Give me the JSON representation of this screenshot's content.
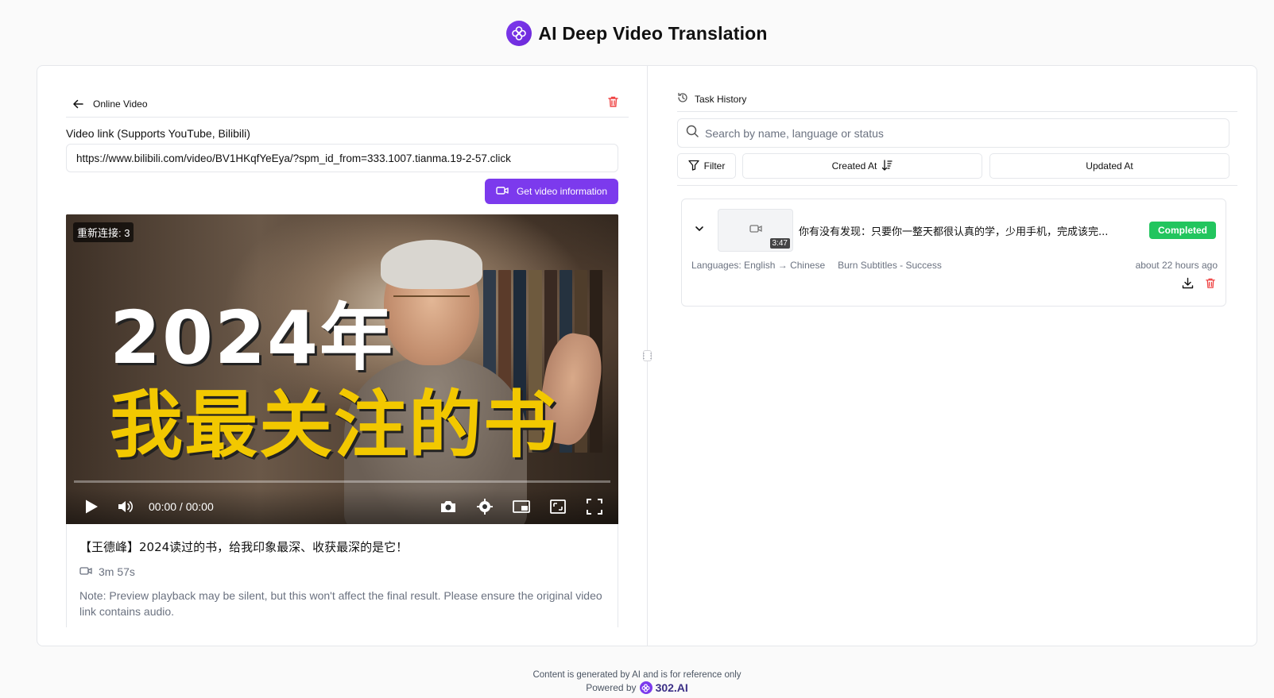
{
  "header": {
    "title": "AI Deep Video Translation",
    "logo_icon": "flower-logo-icon"
  },
  "left": {
    "back_label": "Online Video",
    "field_label": "Video link (Supports YouTube, Bilibili)",
    "url_value": "https://www.bilibili.com/video/BV1HKqfYeEya/?spm_id_from=333.1007.tianma.19-2-57.click",
    "get_button": "Get video information",
    "player": {
      "reconnect": "重新连接: 3",
      "overlay_line1": "2024年",
      "overlay_line2": "我最关注的书",
      "time": "00:00 / 00:00"
    },
    "video_title": "【王德峰】2024读过的书，给我印象最深、收获最深的是它！",
    "duration": "3m 57s",
    "note": "Note: Preview playback may be silent, but this won't affect the final result. Please ensure the original video link contains audio."
  },
  "right": {
    "task_history_label": "Task History",
    "search_placeholder": "Search by name, language or status",
    "filter_label": "Filter",
    "created_at_label": "Created At",
    "updated_at_label": "Updated At",
    "tasks": [
      {
        "title": "你有没有发现：只要你一整天都很认真的学，少用手机，完成该完...",
        "thumb_duration": "3:47",
        "status": "Completed",
        "languages": "Languages: English → Chinese",
        "operation": "Burn Subtitles - Success",
        "time_ago": "about 22 hours ago"
      }
    ]
  },
  "footer": {
    "disclaimer": "Content is generated by AI and is for reference only",
    "powered_by": "Powered by",
    "brand": "302.AI"
  },
  "colors": {
    "accent": "#7c3aed",
    "success": "#22c55e",
    "danger": "#ef4444"
  }
}
